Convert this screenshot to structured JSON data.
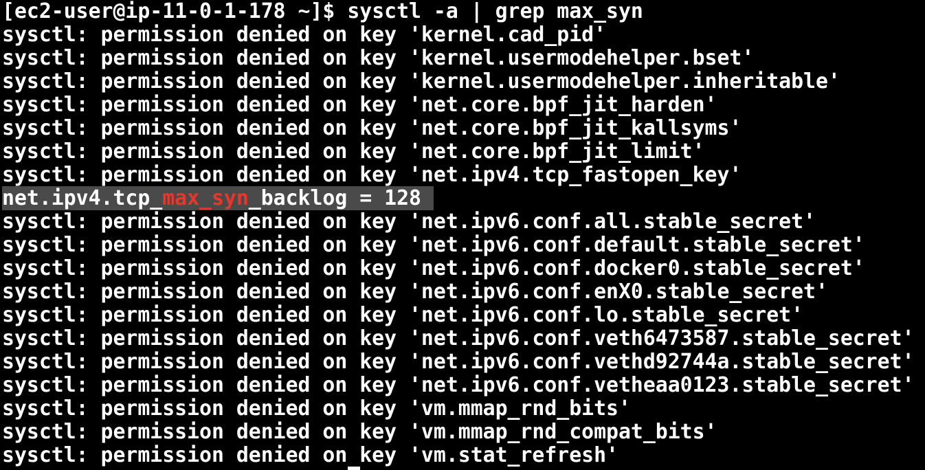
{
  "terminal": {
    "prompt": "[ec2-user@ip-11-0-1-178 ~]$ ",
    "command": "sysctl -a | grep max_syn",
    "output": [
      "sysctl: permission denied on key 'kernel.cad_pid'",
      "sysctl: permission denied on key 'kernel.usermodehelper.bset'",
      "sysctl: permission denied on key 'kernel.usermodehelper.inheritable'",
      "sysctl: permission denied on key 'net.core.bpf_jit_harden'",
      "sysctl: permission denied on key 'net.core.bpf_jit_kallsyms'",
      "sysctl: permission denied on key 'net.core.bpf_jit_limit'",
      "sysctl: permission denied on key 'net.ipv4.tcp_fastopen_key'"
    ],
    "match_line": {
      "before": "net.ipv4.tcp_",
      "match": "max_syn",
      "after": "_backlog = 128 "
    },
    "output_after": [
      "sysctl: permission denied on key 'net.ipv6.conf.all.stable_secret'",
      "sysctl: permission denied on key 'net.ipv6.conf.default.stable_secret'",
      "sysctl: permission denied on key 'net.ipv6.conf.docker0.stable_secret'",
      "sysctl: permission denied on key 'net.ipv6.conf.enX0.stable_secret'",
      "sysctl: permission denied on key 'net.ipv6.conf.lo.stable_secret'",
      "sysctl: permission denied on key 'net.ipv6.conf.veth6473587.stable_secret'",
      "sysctl: permission denied on key 'net.ipv6.conf.vethd92744a.stable_secret'",
      "sysctl: permission denied on key 'net.ipv6.conf.vetheaa0123.stable_secret'",
      "sysctl: permission denied on key 'vm.mmap_rnd_bits'",
      "sysctl: permission denied on key 'vm.mmap_rnd_compat_bits'",
      "sysctl: permission denied on key 'vm.stat_refresh'"
    ],
    "colors": {
      "background": "#000000",
      "text": "#ffffff",
      "match": "#e8372a",
      "highlight": "#4a4a4a"
    }
  }
}
